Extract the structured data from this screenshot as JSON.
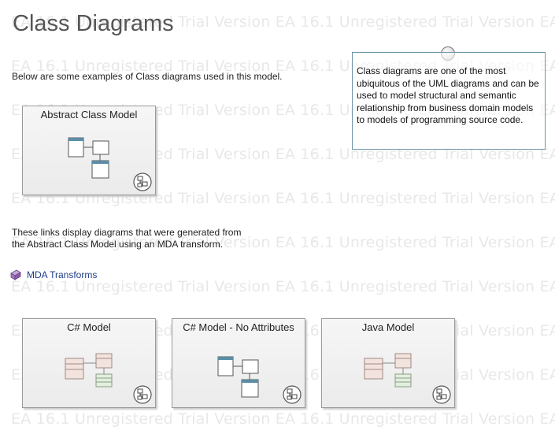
{
  "watermark": {
    "text": "EA 16.1 Unregistered Trial Version",
    "color": "#e8e8e8"
  },
  "page": {
    "title": "Class Diagrams",
    "intro": "Below are some examples of Class diagrams used in this model.",
    "links_text": "These links display diagrams that were generated from the Abstract Class Model using an MDA transform."
  },
  "note": {
    "text": "Class diagrams are one of the most ubiquitous of the UML diagrams and can be used to model structural and semantic relationship from business domain models to models of programming source code."
  },
  "link": {
    "label": "MDA Transforms",
    "icon": "package-link-icon",
    "color": "#1f3d8a"
  },
  "diagrams": [
    {
      "id": "abstract",
      "label": "Abstract Class Model",
      "thumb": "class-thumb-blue"
    },
    {
      "id": "csharp",
      "label": "C# Model",
      "thumb": "class-thumb-colored"
    },
    {
      "id": "csharp-noattr",
      "label": "C# Model - No Attributes",
      "thumb": "class-thumb-blue"
    },
    {
      "id": "java",
      "label": "Java Model",
      "thumb": "class-thumb-colored"
    }
  ],
  "colors": {
    "frame_border": "#9a9a9a",
    "note_border": "#6d94a6",
    "class_header_blue": "#5b8ea6",
    "class_pink": "#f3e3de",
    "class_green": "#e2efdf"
  }
}
